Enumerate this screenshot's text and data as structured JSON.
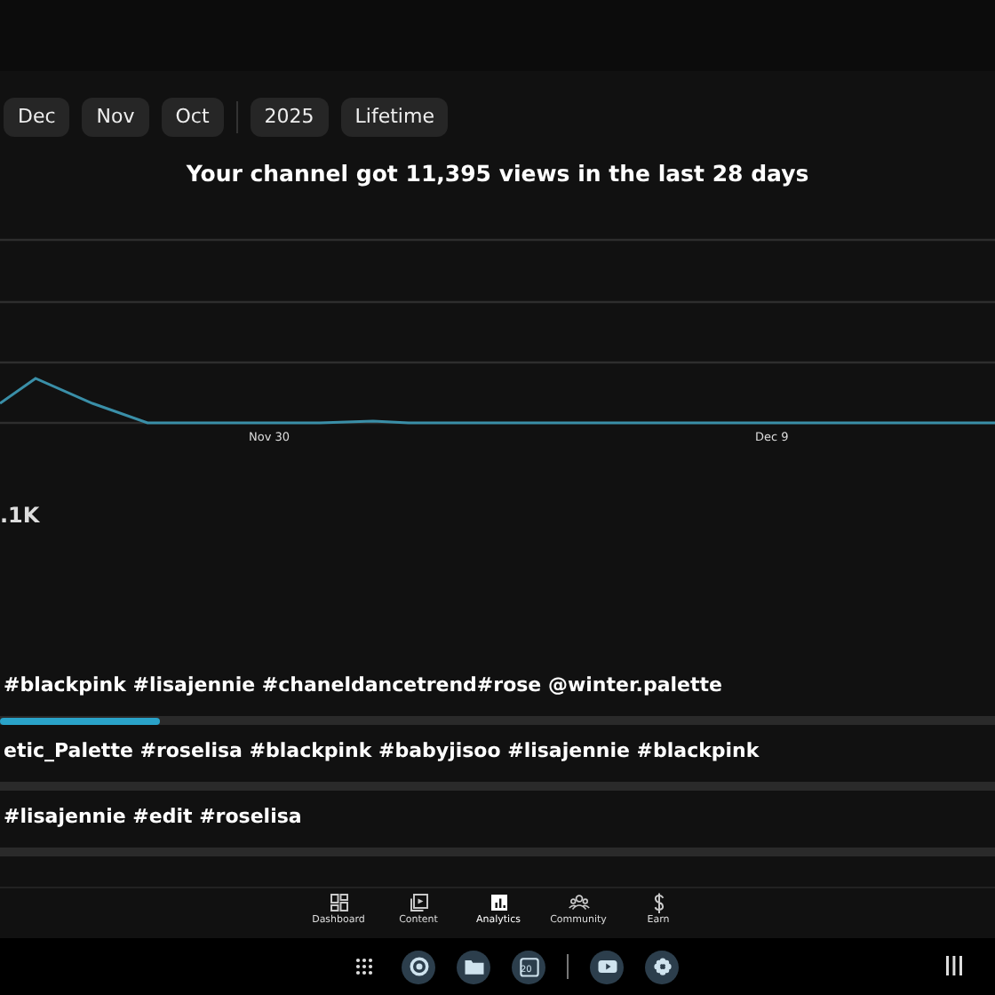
{
  "period_chips": [
    {
      "label": "Dec",
      "selected": false
    },
    {
      "label": "Nov",
      "selected": false
    },
    {
      "label": "Oct",
      "selected": false
    },
    {
      "label": "2025",
      "selected": false
    },
    {
      "label": "Lifetime",
      "selected": false
    }
  ],
  "headline": "Your channel got 11,395 views in the last 28 days",
  "chart": {
    "x_labels": [
      "Nov 30",
      "Dec 9"
    ]
  },
  "stat_value": ".1K",
  "videos": [
    {
      "title": "#blackpink #lisajennie #chaneldancetrend#rose @winter.palette",
      "level": 0.16
    },
    {
      "title": "etic_Palette  #roselisa #blackpink #babyjisoo #lisajennie #blackpink"
    },
    {
      "title": "#lisajennie #edit #roselisa"
    }
  ],
  "bottom_nav": [
    {
      "label": "Dashboard",
      "selected": false
    },
    {
      "label": "Content",
      "selected": false
    },
    {
      "label": "Analytics",
      "selected": true
    },
    {
      "label": "Community",
      "selected": false
    },
    {
      "label": "Earn",
      "selected": false
    }
  ],
  "taskbar": {
    "calendar_day": "20"
  }
}
